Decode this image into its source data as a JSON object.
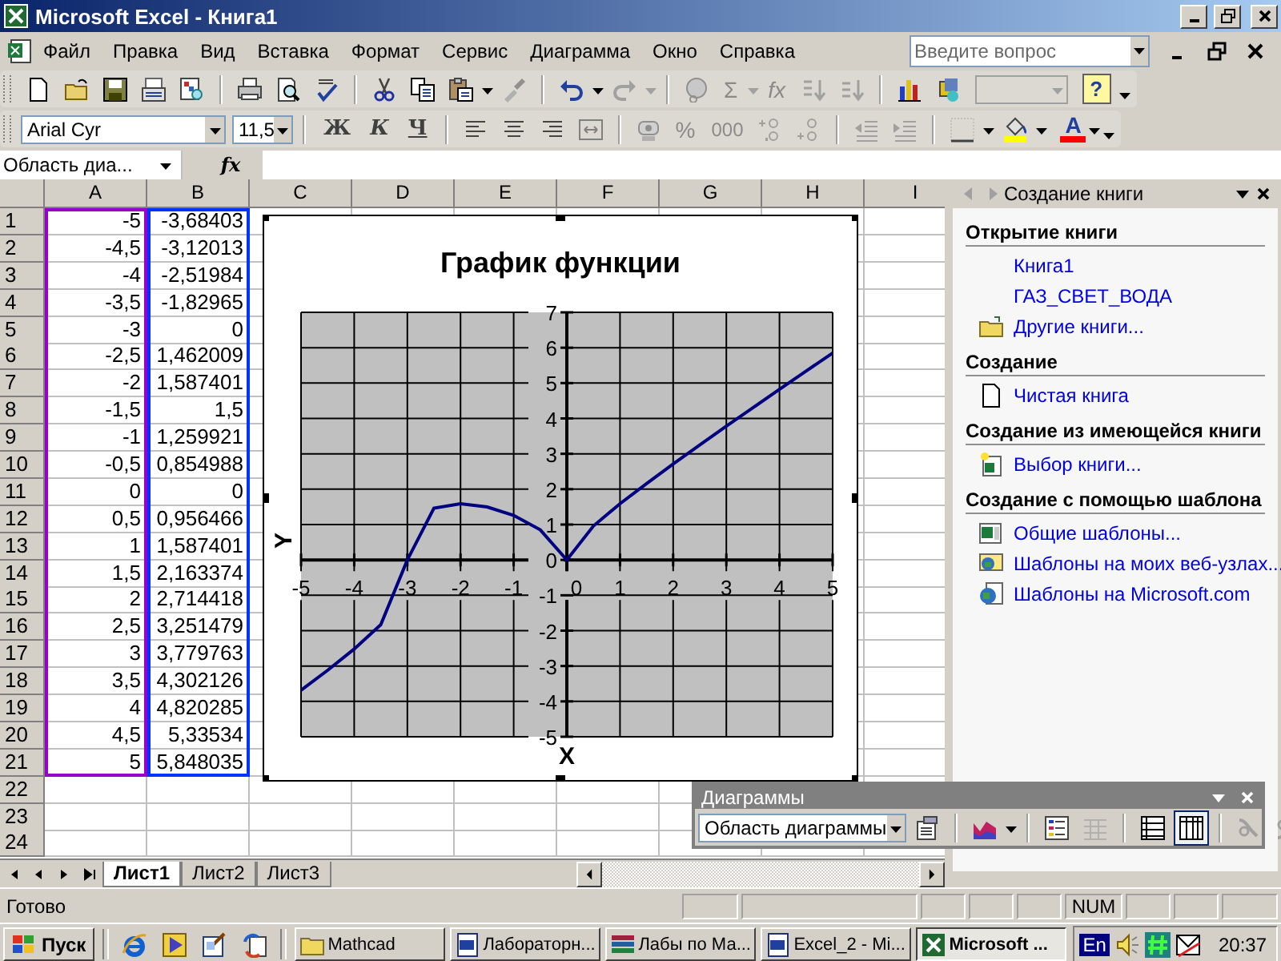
{
  "window": {
    "title": "Microsoft Excel - Книга1"
  },
  "menu": [
    "Файл",
    "Правка",
    "Вид",
    "Вставка",
    "Формат",
    "Сервис",
    "Диаграмма",
    "Окно",
    "Справка"
  ],
  "help_search": {
    "placeholder": "Введите вопрос"
  },
  "standard_toolbar": {
    "sum": "Σ",
    "function": "fx",
    "help": "?"
  },
  "formatting_toolbar": {
    "font": "Arial Cyr",
    "size": "11,5",
    "style_buttons": [
      "Ж",
      "К",
      "Ч"
    ],
    "percent": "%",
    "thousands": "000",
    "font_color": "A"
  },
  "formula_bar": {
    "name_box": "Область диа...",
    "fx": "fx"
  },
  "sheet": {
    "columns": [
      "A",
      "B",
      "C",
      "D",
      "E",
      "F",
      "G",
      "H",
      "I"
    ],
    "rows": [
      {
        "number": "1",
        "a": "-5",
        "b": "-3,68403"
      },
      {
        "number": "2",
        "a": "-4,5",
        "b": "-3,12013"
      },
      {
        "number": "3",
        "a": "-4",
        "b": "-2,51984"
      },
      {
        "number": "4",
        "a": "-3,5",
        "b": "-1,82965"
      },
      {
        "number": "5",
        "a": "-3",
        "b": "0"
      },
      {
        "number": "6",
        "a": "-2,5",
        "b": "1,462009"
      },
      {
        "number": "7",
        "a": "-2",
        "b": "1,587401"
      },
      {
        "number": "8",
        "a": "-1,5",
        "b": "1,5"
      },
      {
        "number": "9",
        "a": "-1",
        "b": "1,259921"
      },
      {
        "number": "10",
        "a": "-0,5",
        "b": "0,854988"
      },
      {
        "number": "11",
        "a": "0",
        "b": "0"
      },
      {
        "number": "12",
        "a": "0,5",
        "b": "0,956466"
      },
      {
        "number": "13",
        "a": "1",
        "b": "1,587401"
      },
      {
        "number": "14",
        "a": "1,5",
        "b": "2,163374"
      },
      {
        "number": "15",
        "a": "2",
        "b": "2,714418"
      },
      {
        "number": "16",
        "a": "2,5",
        "b": "3,251479"
      },
      {
        "number": "17",
        "a": "3",
        "b": "3,779763"
      },
      {
        "number": "18",
        "a": "3,5",
        "b": "4,302126"
      },
      {
        "number": "19",
        "a": "4",
        "b": "4,820285"
      },
      {
        "number": "20",
        "a": "4,5",
        "b": "5,33534"
      },
      {
        "number": "21",
        "a": "5",
        "b": "5,848035"
      },
      {
        "number": "22"
      },
      {
        "number": "23"
      },
      {
        "number": "24"
      }
    ]
  },
  "chart": {
    "chart_data": {
      "type": "line",
      "title": "График функции",
      "xlabel": "X",
      "ylabel": "Y",
      "x": [
        -5,
        -4.5,
        -4,
        -3.5,
        -3,
        -2.5,
        -2,
        -1.5,
        -1,
        -0.5,
        0,
        0.5,
        1,
        1.5,
        2,
        2.5,
        3,
        3.5,
        4,
        4.5,
        5
      ],
      "series": [
        {
          "color": "#000080",
          "values": [
            -3.68,
            -3.12,
            -2.52,
            -1.83,
            0,
            1.46,
            1.59,
            1.5,
            1.26,
            0.85,
            0,
            0.96,
            1.59,
            2.16,
            2.71,
            3.25,
            3.78,
            4.3,
            4.82,
            5.34,
            5.85
          ]
        }
      ],
      "xlim": [
        -5,
        5
      ],
      "ylim": [
        -5,
        7
      ],
      "grid": true,
      "xticks": [
        -5,
        -4,
        -3,
        -2,
        -1,
        0,
        1,
        2,
        3,
        4,
        5
      ],
      "yticks": [
        -5,
        -4,
        -3,
        -2,
        -1,
        0,
        1,
        2,
        3,
        4,
        5,
        6,
        7
      ]
    }
  },
  "task_pane": {
    "title": "Создание книги",
    "sections": [
      {
        "heading": "Открытие книги",
        "items": [
          {
            "label": "Книга1",
            "kind": "recent"
          },
          {
            "label": "ГАЗ_СВЕТ_ВОДА",
            "kind": "recent"
          },
          {
            "label": "Другие книги...",
            "kind": "folder"
          }
        ]
      },
      {
        "heading": "Создание",
        "items": [
          {
            "label": "Чистая книга",
            "kind": "blank"
          }
        ]
      },
      {
        "heading": "Создание из имеющейся книги",
        "items": [
          {
            "label": "Выбор книги...",
            "kind": "workbook"
          }
        ]
      },
      {
        "heading": "Создание с помощью шаблона",
        "items": [
          {
            "label": "Общие шаблоны...",
            "kind": "template"
          },
          {
            "label": "Шаблоны на моих веб-узлах...",
            "kind": "web_template"
          },
          {
            "label": "Шаблоны на Microsoft.com",
            "kind": "web"
          }
        ]
      }
    ]
  },
  "sheet_tabs": [
    {
      "label": "Лист1",
      "selected": true
    },
    {
      "label": "Лист2",
      "selected": false
    },
    {
      "label": "Лист3",
      "selected": false
    }
  ],
  "chart_toolbar": {
    "title": "Диаграммы",
    "object": "Область диаграммы",
    "series_in": [
      {
        "kind": "rows",
        "selected": false
      },
      {
        "kind": "columns",
        "selected": true
      }
    ]
  },
  "status_bar": {
    "status": "Готово",
    "indicator": "NUM"
  },
  "taskbar": {
    "start": "Пуск",
    "tasks": [
      {
        "label": "Mathcad",
        "kind": "folder",
        "selected": false
      },
      {
        "label": "Лабораторн...",
        "kind": "word",
        "selected": false
      },
      {
        "label": "Лабы по Ма...",
        "kind": "books",
        "selected": false
      },
      {
        "label": "Excel_2 - Mi...",
        "kind": "word",
        "selected": false
      },
      {
        "label": "Microsoft ...",
        "kind": "excel",
        "selected": true
      }
    ],
    "language": "En",
    "time": "20:37"
  }
}
